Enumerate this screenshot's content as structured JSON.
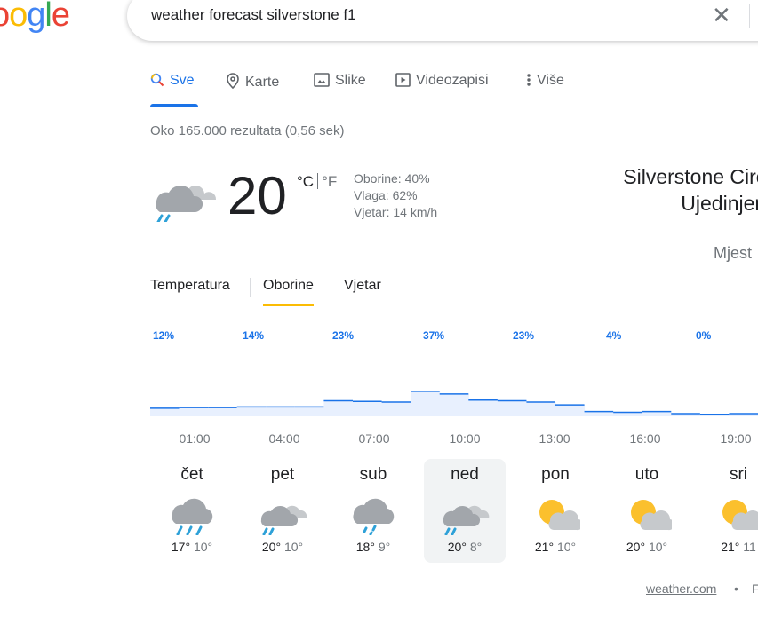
{
  "logo": {
    "partial": "oogle"
  },
  "search": {
    "query": "weather forecast silverstone f1"
  },
  "tabs": [
    {
      "label": "Sve",
      "icon": "search-icon",
      "active": true
    },
    {
      "label": "Karte",
      "icon": "map-pin-icon"
    },
    {
      "label": "Slike",
      "icon": "image-icon"
    },
    {
      "label": "Videozapisi",
      "icon": "video-icon"
    },
    {
      "label": "Više",
      "icon": "more-vert-icon"
    }
  ],
  "result_stats": "Oko 165.000 rezultata (0,56 sek)",
  "weather": {
    "current_temp": "20",
    "unit_c": "°C",
    "unit_f": "°F",
    "precip": "Oborine: 40%",
    "humidity": "Vlaga: 62%",
    "wind": "Vjetar: 14 km/h",
    "location_line1": "Silverstone Circuit,",
    "location_line2": "Ujedinjeno",
    "place_partial": "Mjest",
    "chart_tabs": [
      "Temperatura",
      "Oborine",
      "Vjetar"
    ],
    "active_chart_tab": "Oborine",
    "precip_labels": [
      "12%",
      "14%",
      "23%",
      "37%",
      "23%",
      "4%",
      "0%"
    ],
    "times": [
      "01:00",
      "04:00",
      "07:00",
      "10:00",
      "13:00",
      "16:00",
      "19:00"
    ],
    "days": [
      {
        "name": "čet",
        "high": "17°",
        "low": "10°",
        "icon": "heavy-rain-icon"
      },
      {
        "name": "pet",
        "high": "20°",
        "low": "10°",
        "icon": "rain-showers-icon"
      },
      {
        "name": "sub",
        "high": "18°",
        "low": "9°",
        "icon": "light-rain-icon"
      },
      {
        "name": "ned",
        "high": "20°",
        "low": "8°",
        "icon": "rain-showers-icon",
        "selected": true
      },
      {
        "name": "pon",
        "high": "21°",
        "low": "10°",
        "icon": "partly-sunny-icon"
      },
      {
        "name": "uto",
        "high": "20°",
        "low": "10°",
        "icon": "partly-sunny-icon"
      },
      {
        "name": "sri",
        "high": "21°",
        "low": "11",
        "icon": "partly-sunny-icon"
      }
    ],
    "source": "weather.com",
    "source_sep": "•",
    "source_more": "F"
  },
  "chart_data": {
    "type": "area",
    "series": [
      {
        "values": [
          12,
          13,
          13,
          14,
          14,
          14,
          23,
          22,
          21,
          37,
          33,
          24,
          23,
          21,
          17,
          7,
          6,
          7,
          4,
          3,
          4
        ]
      }
    ],
    "ylim": [
      0,
      100
    ],
    "colors": {
      "fill": "#e8f0fe",
      "line": "#1a73e8"
    }
  }
}
